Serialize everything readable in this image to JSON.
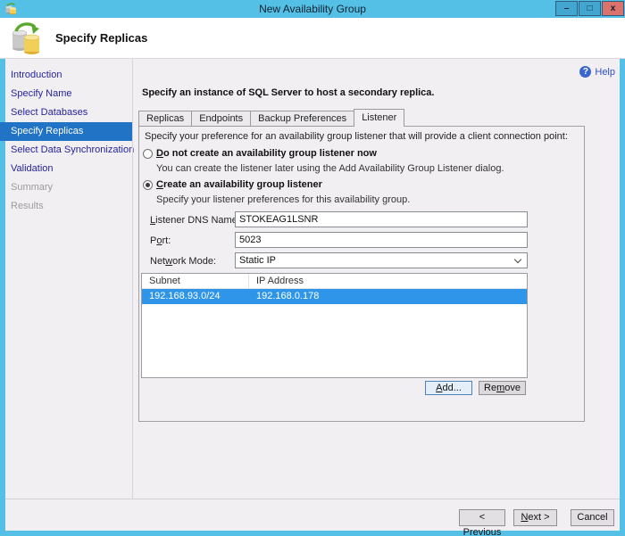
{
  "window": {
    "title": "New Availability Group",
    "controls": {
      "minimize": "–",
      "maximize": "□",
      "close": "x"
    }
  },
  "header": {
    "title": "Specify Replicas"
  },
  "sidebar": {
    "items": [
      {
        "label": "Introduction",
        "state": "link"
      },
      {
        "label": "Specify Name",
        "state": "link"
      },
      {
        "label": "Select Databases",
        "state": "link"
      },
      {
        "label": "Specify Replicas",
        "state": "selected"
      },
      {
        "label": "Select Data Synchronization",
        "state": "link"
      },
      {
        "label": "Validation",
        "state": "link"
      },
      {
        "label": "Summary",
        "state": "disabled"
      },
      {
        "label": "Results",
        "state": "disabled"
      }
    ]
  },
  "content": {
    "help_label": "Help",
    "help_glyph": "?",
    "heading": "Specify an instance of SQL Server to host a secondary replica.",
    "tabs": [
      {
        "label": "Replicas",
        "active": false
      },
      {
        "label": "Endpoints",
        "active": false
      },
      {
        "label": "Backup Preferences",
        "active": false
      },
      {
        "label": "Listener",
        "active": true
      }
    ],
    "listener": {
      "intro": "Specify your preference for an availability group listener that will provide a client connection point:",
      "options": [
        {
          "label": "&Do not create an availability group listener now",
          "description": "You can create the listener later using the Add Availability Group Listener dialog.",
          "selected": false
        },
        {
          "label": "&Create an availability group listener",
          "description": "Specify your listener preferences for this availability group.",
          "selected": true
        }
      ],
      "fields": {
        "dns": {
          "label": "&Listener DNS Name:",
          "value": "STOKEAG1LSNR"
        },
        "port": {
          "label": "P&ort:",
          "value": "5023"
        },
        "network_mode": {
          "label": "Net&work Mode:",
          "value": "Static IP"
        }
      },
      "table": {
        "columns": [
          "Subnet",
          "IP Address"
        ],
        "rows": [
          {
            "subnet": "192.168.93.0/24",
            "ip": "192.168.0.178",
            "selected": true
          }
        ]
      },
      "add_label": "&Add...",
      "remove_label": "Re&move"
    }
  },
  "footer": {
    "previous_label": "< &Previous",
    "next_label": "&Next >",
    "cancel_label": "Cancel"
  },
  "colors": {
    "titlebar": "#54c0e6",
    "nav_selection": "#2173c6",
    "row_selection": "#2e95e8",
    "nav_link": "#24249c",
    "help_link": "#2d50c8",
    "close_button": "#d9736b"
  }
}
